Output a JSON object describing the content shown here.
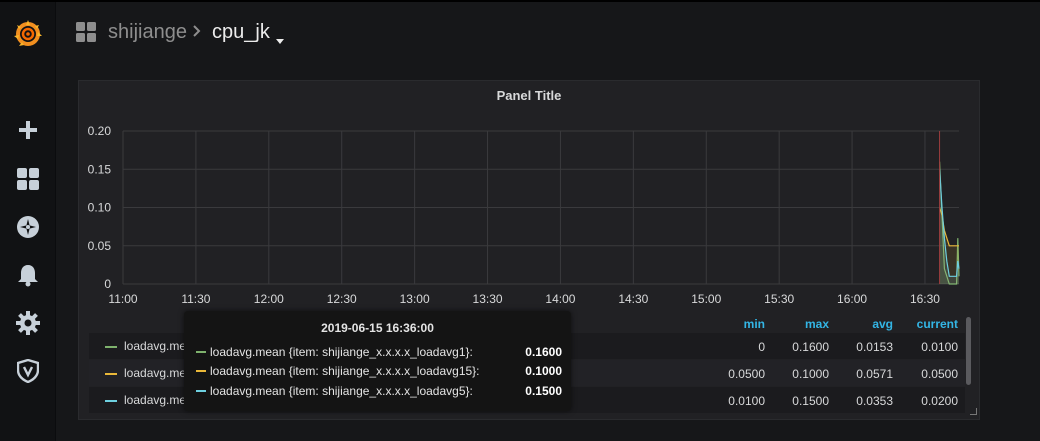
{
  "colors": {
    "series_green": "#7eb26d",
    "series_yellow": "#eab839",
    "series_cyan": "#6ed0e0",
    "legend_header": "#33b5e5",
    "brand_orange": "#f28f1f"
  },
  "sidebar": {
    "items": [
      {
        "icon": "grafana-logo-icon"
      },
      {
        "icon": "plus-icon"
      },
      {
        "icon": "dashboards-icon"
      },
      {
        "icon": "explore-icon"
      },
      {
        "icon": "alerting-bell-icon"
      },
      {
        "icon": "configuration-gear-icon"
      },
      {
        "icon": "server-admin-shield-icon"
      }
    ]
  },
  "header": {
    "folder": "shijiange",
    "dashboard_title": "cpu_jk"
  },
  "panel": {
    "title": "Panel Title",
    "legend": {
      "columns": [
        "min",
        "max",
        "avg",
        "current"
      ],
      "rows": [
        {
          "name": "loadavg.mean",
          "color": "#7eb26d",
          "min": "0",
          "max": "0.1600",
          "avg": "0.0153",
          "current": "0.0100"
        },
        {
          "name": "loadavg.mean",
          "color": "#eab839",
          "min": "0.0500",
          "max": "0.1000",
          "avg": "0.0571",
          "current": "0.0500"
        },
        {
          "name": "loadavg.mean",
          "color": "#6ed0e0",
          "min": "0.0100",
          "max": "0.1500",
          "avg": "0.0353",
          "current": "0.0200"
        }
      ]
    },
    "tooltip": {
      "time": "2019-06-15 16:36:00",
      "rows": [
        {
          "label": "loadavg.mean {item: shijiange_x.x.x.x_loadavg1}:",
          "value": "0.1600",
          "color": "#7eb26d"
        },
        {
          "label": "loadavg.mean {item: shijiange_x.x.x.x_loadavg15}:",
          "value": "0.1000",
          "color": "#eab839"
        },
        {
          "label": "loadavg.mean {item: shijiange_x.x.x.x_loadavg5}:",
          "value": "0.1500",
          "color": "#6ed0e0"
        }
      ]
    }
  },
  "chart_data": {
    "type": "line",
    "title": "Panel Title",
    "x_ticks": [
      "11:00",
      "11:30",
      "12:00",
      "12:30",
      "13:00",
      "13:30",
      "14:00",
      "14:30",
      "15:00",
      "15:30",
      "16:00",
      "16:30"
    ],
    "y_ticks": [
      "0",
      "0.05",
      "0.10",
      "0.15",
      "0.20"
    ],
    "xlim": [
      "11:00",
      "16:44"
    ],
    "ylim": [
      0,
      0.2
    ],
    "grid": true,
    "legend_placement": "bottom-table",
    "series": [
      {
        "name": "loadavg.mean",
        "color": "#7eb26d",
        "fill": true,
        "points": [
          [
            "16:36",
            0.16
          ],
          [
            "16:38",
            0.02
          ],
          [
            "16:40",
            0.0
          ],
          [
            "16:42",
            0.0
          ],
          [
            "16:43",
            0.0
          ],
          [
            "16:43.5",
            0.06
          ],
          [
            "16:44",
            0.01
          ]
        ]
      },
      {
        "name": "loadavg.mean",
        "color": "#eab839",
        "fill": true,
        "points": [
          [
            "16:36",
            0.1
          ],
          [
            "16:37",
            0.09
          ],
          [
            "16:38",
            0.07
          ],
          [
            "16:39",
            0.06
          ],
          [
            "16:40",
            0.05
          ],
          [
            "16:42",
            0.05
          ],
          [
            "16:44",
            0.05
          ]
        ]
      },
      {
        "name": "loadavg.mean",
        "color": "#6ed0e0",
        "fill": true,
        "points": [
          [
            "16:36",
            0.15
          ],
          [
            "16:37",
            0.1
          ],
          [
            "16:38",
            0.06
          ],
          [
            "16:39",
            0.03
          ],
          [
            "16:40",
            0.01
          ],
          [
            "16:42",
            0.01
          ],
          [
            "16:43",
            0.01
          ],
          [
            "16:43.5",
            0.03
          ],
          [
            "16:44",
            0.02
          ]
        ]
      }
    ]
  }
}
